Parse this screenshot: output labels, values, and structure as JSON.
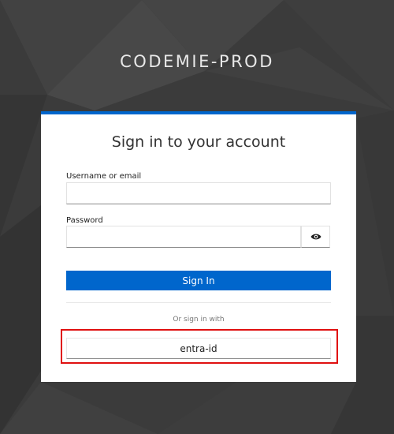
{
  "realm": {
    "title": "CODEMIE-PROD"
  },
  "login": {
    "heading": "Sign in to your account",
    "username_label": "Username or email",
    "username_value": "",
    "password_label": "Password",
    "password_value": "",
    "show_password_icon": "eye-icon",
    "submit_label": "Sign In",
    "social_divider_text": "Or sign in with",
    "providers": [
      {
        "label": "entra-id"
      }
    ]
  },
  "colors": {
    "primary": "#0066cc",
    "highlight": "#e01010",
    "background": "#3a3a3a"
  }
}
